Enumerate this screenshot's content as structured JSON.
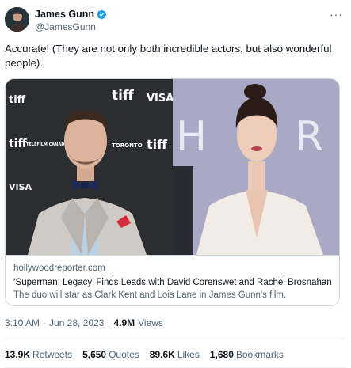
{
  "author": {
    "display_name": "James Gunn",
    "handle": "@JamesGunn",
    "verified_icon": "verified-badge-icon",
    "more_label": "···"
  },
  "tweet": {
    "text": "Accurate! (They are not only both incredible actors, but also wonderful people)."
  },
  "card": {
    "domain": "hollywoodreporter.com",
    "title": "‘Superman: Legacy’ Finds Leads with David Corenswet and Rachel Brosnahan",
    "description": "The duo will star as Clark Kent and Lois Lane in James Gunn's film.",
    "backdrop_left": {
      "words": [
        "tiff",
        "tiff",
        "VISA",
        "tiff",
        "tiff",
        "VISA",
        "TORONTO",
        "TELEFILM CANADA"
      ],
      "colors": {
        "backdrop": "#2b2d31",
        "text": "#ffffff"
      }
    },
    "backdrop_right": {
      "letters": [
        "H",
        "R"
      ],
      "colors": {
        "backdrop": "#a9a9c6",
        "text": "#ffffff"
      }
    }
  },
  "meta": {
    "time": "3:10 AM",
    "separator": "·",
    "date": "Jun 28, 2023",
    "separator2": "·",
    "views_count": "4.9M",
    "views_label": "Views"
  },
  "stats": [
    {
      "count": "13.9K",
      "label": "Retweets"
    },
    {
      "count": "5,650",
      "label": "Quotes"
    },
    {
      "count": "89.6K",
      "label": "Likes"
    },
    {
      "count": "1,680",
      "label": "Bookmarks"
    }
  ],
  "colors": {
    "text_primary": "#0f1419",
    "text_secondary": "#536471",
    "border": "#cfd9de",
    "verified_blue": "#1d9bf0"
  }
}
